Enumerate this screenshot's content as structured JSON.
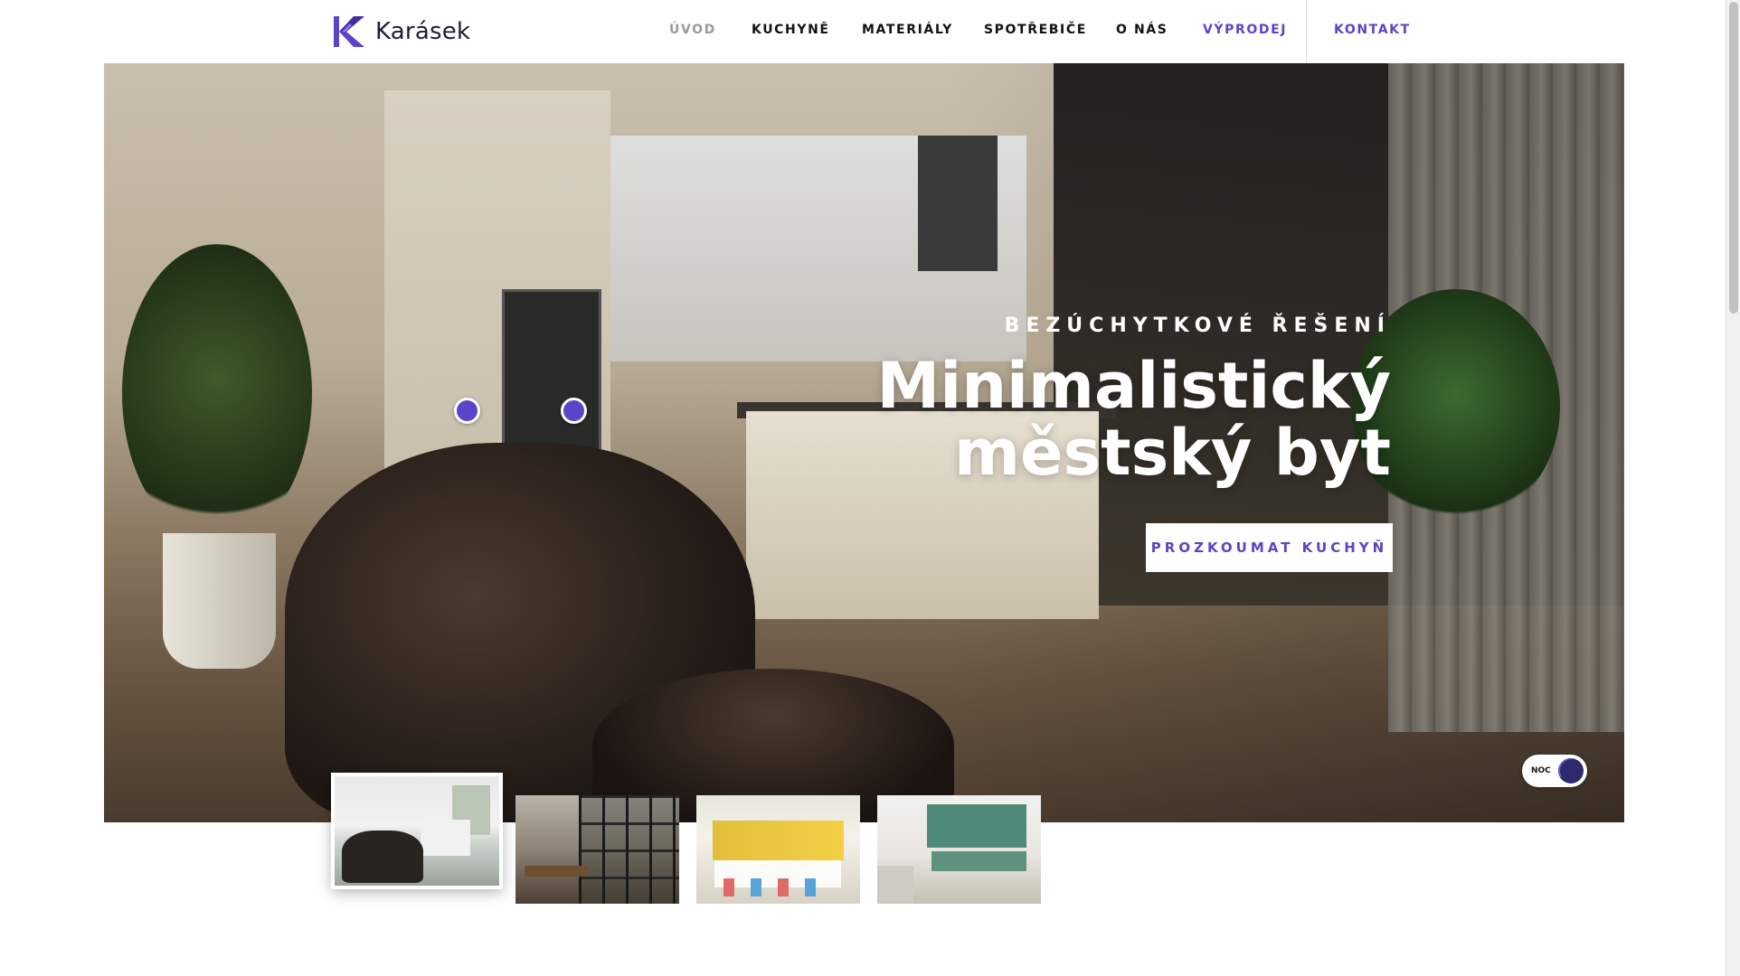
{
  "brand": {
    "name": "Karásek",
    "accent": "#5a44c8",
    "logo_icon": "k-logo-icon"
  },
  "nav": {
    "items": [
      {
        "label": "ÚVOD",
        "state": "muted"
      },
      {
        "label": "KUCHYNĚ",
        "state": "default"
      },
      {
        "label": "MATERIÁLY",
        "state": "default"
      },
      {
        "label": "SPOTŘEBIČE",
        "state": "default"
      },
      {
        "label": "O NÁS",
        "state": "default"
      },
      {
        "label": "VÝPRODEJ",
        "state": "accent"
      }
    ],
    "contact_label": "KONTAKT"
  },
  "hero": {
    "eyebrow": "BEZÚCHYTKOVÉ ŘEŠENÍ",
    "title_line1": "Minimalistický",
    "title_line2": "městský byt",
    "cta_label": "PROZKOUMAT KUCHYŇ",
    "hotspot_count": 2,
    "night_toggle": {
      "label": "NOC",
      "icon": "moon-icon",
      "on": true
    }
  },
  "thumbnails": {
    "count": 4,
    "active_index": 0
  },
  "colors": {
    "accent": "#5a44c8",
    "nav_muted": "#9a9a9a",
    "text": "#111111",
    "night_knob": "#2d2a6e"
  }
}
